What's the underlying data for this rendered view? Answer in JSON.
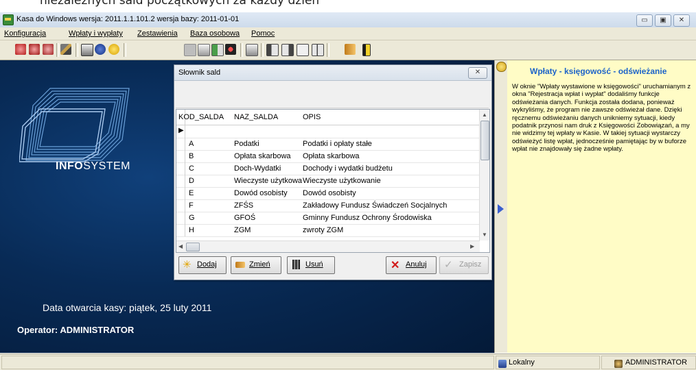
{
  "doc_snippet": "nieżależnych sald początkowych za każdy dzień",
  "window": {
    "title": "Kasa do Windows wersja: 2011.1.1.101.2 wersja bazy: 2011-01-01",
    "btn_min": "▭",
    "btn_max": "▣",
    "btn_close": "✕"
  },
  "menu": [
    "Konfiguracja",
    "Wpłaty i wypłaty",
    "Zestawienia",
    "Baza osobowa",
    "Pomoc"
  ],
  "toolbar_icons": [
    "print-icon",
    "print-preview-icon",
    "print-setup-icon",
    "tools-icon",
    "printer-icon",
    "info-icon",
    "help-icon",
    "stop-icon",
    "comment-icon",
    "table-icon",
    "record-icon",
    "export-icon",
    "copy-icon",
    "page-icon",
    "document-icon",
    "copy-pages-icon",
    "pointer-icon",
    "exit-icon"
  ],
  "main": {
    "brand_bold": "INFO",
    "brand_rest": "SYSTEM",
    "date_line": "Data otwarcia kasy: piątek, 25 luty 2011",
    "operator_line": "Operator: ADMINISTRATOR"
  },
  "dialog": {
    "title": "Słownik sald",
    "close": "✕",
    "columns": [
      "KOD_SALDA",
      "NAZ_SALDA",
      "OPIS"
    ],
    "rows": [
      {
        "kod": "",
        "naz": "",
        "opis": ""
      },
      {
        "kod": "A",
        "naz": "Podatki",
        "opis": "Podatki i opłaty stałe"
      },
      {
        "kod": "B",
        "naz": "Opłata skarbowa",
        "opis": "Opłata skarbowa"
      },
      {
        "kod": "C",
        "naz": "Doch-Wydatki",
        "opis": "Dochody i wydatki budżetu"
      },
      {
        "kod": "D",
        "naz": "Wieczyste użytkowa",
        "opis": "Wieczyste użytkowanie"
      },
      {
        "kod": "E",
        "naz": "Dowód osobisty",
        "opis": "Dowód osobisty"
      },
      {
        "kod": "F",
        "naz": "ZFŚS",
        "opis": "Zakładowy Fundusz Świadczeń Socjalnych"
      },
      {
        "kod": "G",
        "naz": "GFOŚ",
        "opis": "Gminny Fundusz Ochrony Środowiska"
      },
      {
        "kod": "H",
        "naz": "ZGM",
        "opis": "zwroty ZGM"
      }
    ],
    "buttons": {
      "dodaj": "Dodaj",
      "zmien": "Zmień",
      "usun": "Usuń",
      "anuluj": "Anuluj",
      "zapisz": "Zapisz"
    }
  },
  "help": {
    "title": "Wpłaty - księgowość - odświeżanie",
    "body": "W oknie \"Wpłaty wystawione w księgowości\" uruchamianym z okna \"Rejestracja wpłat i wypłat\" dodaliśmy funkcje odświeżania danych. Funkcja została dodana, ponieważ wykryliśmy, że program nie zawsze odświeżał dane. Dzięki ręcznemu odświeżaniu danych unikniemy sytuacji, kiedy podatnik przynosi nam druk z Księgowości Zobowiązań, a my nie widzimy tej wpłaty w Kasie. W takiej sytuacji wystarczy odświeżyć listę wpłat, jednocześnie pamiętając by w buforze wpłat nie znajdowały się żadne wpłaty."
  },
  "status": {
    "location": "Lokalny",
    "user": "ADMINISTRATOR"
  },
  "colors": {
    "background_blue": "#082a55",
    "help_background": "#fffcc6",
    "help_title": "#1c63c9"
  }
}
